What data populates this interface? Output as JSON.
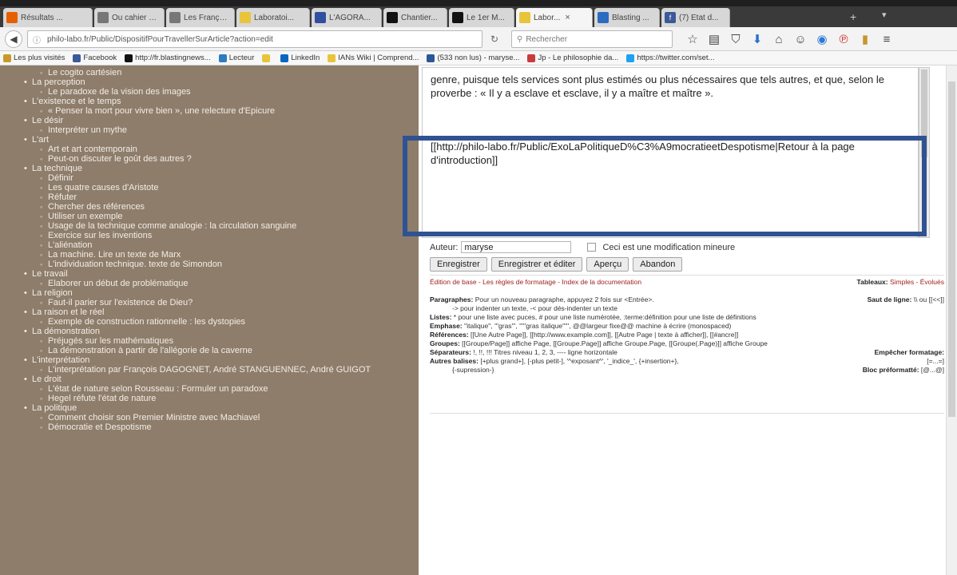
{
  "tabs": [
    {
      "title": "Résultats ...",
      "favicon": "firefox",
      "color": "#e66000"
    },
    {
      "title": "Ou cahier de l...",
      "favicon": "page",
      "color": "#777777"
    },
    {
      "title": "Les Français a...",
      "favicon": "page",
      "color": "#777777"
    },
    {
      "title": "Laboratoi...",
      "favicon": "yellow",
      "color": "#e8c43a"
    },
    {
      "title": "L'AGORA...",
      "favicon": "agora",
      "color": "#2f4f9f"
    },
    {
      "title": "Chantier...",
      "favicon": "dot",
      "color": "#111111"
    },
    {
      "title": "Le 1er M...",
      "favicon": "dot",
      "color": "#111111"
    },
    {
      "title": "Labor...",
      "favicon": "philo",
      "color": "#e8c43a",
      "active": true
    },
    {
      "title": "Blasting ...",
      "favicon": "blasting",
      "color": "#2c6bbf"
    },
    {
      "title": "(7) Etat d...",
      "favicon": "facebook",
      "color": "#3b5998"
    }
  ],
  "nav": {
    "url": "philo-labo.fr/Public/DispositifPourTravellerSurArticle?action=edit",
    "search_placeholder": "Rechercher"
  },
  "bookmarks": [
    {
      "label": "Les plus visités",
      "color": "#c89a2a"
    },
    {
      "label": "Facebook",
      "color": "#3b5998"
    },
    {
      "label": "http://fr.blastingnews...",
      "color": "#111111"
    },
    {
      "label": "Lecteur",
      "color": "#2c7cc0"
    },
    {
      "label": "",
      "color": "#e8c43a"
    },
    {
      "label": "LinkedIn",
      "color": "#0a66c2"
    },
    {
      "label": "IANs Wiki | Comprend...",
      "color": "#e8c43a"
    },
    {
      "label": "(533 non lus) - maryse...",
      "color": "#2b5797"
    },
    {
      "label": "Jp - Le philosophie da...",
      "color": "#cc3b3b"
    },
    {
      "label": "https://twitter.com/set...",
      "color": "#1da1f2"
    }
  ],
  "sidebar": [
    {
      "level": "sub",
      "label": "Le cogito cartésien"
    },
    {
      "level": "cat",
      "label": "La perception"
    },
    {
      "level": "sub",
      "label": "Le paradoxe de la vision des images"
    },
    {
      "level": "cat",
      "label": "L'existence et le temps"
    },
    {
      "level": "sub",
      "label": "« Penser la mort pour vivre bien », une relecture d'Epicure"
    },
    {
      "level": "cat",
      "label": "Le désir"
    },
    {
      "level": "sub",
      "label": "Interpréter un mythe"
    },
    {
      "level": "cat",
      "label": "L'art"
    },
    {
      "level": "sub",
      "label": "Art et art contemporain"
    },
    {
      "level": "sub",
      "label": "Peut-on discuter le goût des autres ?"
    },
    {
      "level": "cat",
      "label": "La technique"
    },
    {
      "level": "sub",
      "label": "Définir"
    },
    {
      "level": "sub",
      "label": "Les quatre causes d'Aristote"
    },
    {
      "level": "sub",
      "label": "Réfuter"
    },
    {
      "level": "sub",
      "label": "Chercher des références"
    },
    {
      "level": "sub",
      "label": "Utiliser un exemple"
    },
    {
      "level": "sub",
      "label": "Usage de la technique comme analogie : la circulation sanguine"
    },
    {
      "level": "sub",
      "label": "Exercice sur les inventions"
    },
    {
      "level": "sub",
      "label": "L'aliénation"
    },
    {
      "level": "sub",
      "label": "La machine. Lire un texte de Marx"
    },
    {
      "level": "sub",
      "label": "L'individuation technique. texte de Simondon"
    },
    {
      "level": "cat",
      "label": "Le travail"
    },
    {
      "level": "sub",
      "label": "Elaborer un début de problématique"
    },
    {
      "level": "cat",
      "label": "La religion"
    },
    {
      "level": "sub",
      "label": "Faut-il parier sur l'existence de Dieu?"
    },
    {
      "level": "cat",
      "label": "La raison et le réel"
    },
    {
      "level": "sub",
      "label": "Exemple de construction rationnelle : les dystopies"
    },
    {
      "level": "cat",
      "label": "La démonstration"
    },
    {
      "level": "sub",
      "label": "Préjugés sur les mathématiques"
    },
    {
      "level": "sub",
      "label": "La démonstration à partir de l'allégorie de la caverne"
    },
    {
      "level": "cat",
      "label": "L'interprétation"
    },
    {
      "level": "sub",
      "label": "L'interprétation par François DAGOGNET, André STANGUENNEC, André GUIGOT"
    },
    {
      "level": "cat",
      "label": "Le droit"
    },
    {
      "level": "sub",
      "label": "L'état de nature selon Rousseau : Formuler un paradoxe"
    },
    {
      "level": "sub",
      "label": "Hegel réfute l'état de nature"
    },
    {
      "level": "cat",
      "label": "La politique"
    },
    {
      "level": "sub",
      "label": "Comment choisir son Premier Ministre avec Machiavel"
    },
    {
      "level": "sub",
      "label": "Démocratie et Despotisme"
    }
  ],
  "editor": {
    "para1": "genre, puisque tels services sont plus estimés ou plus nécessaires que tels autres, et que, selon le proverbe : « Il y a esclave et esclave, il y a maître et maître ».",
    "para2": "[[http://philo-labo.fr/Public/ExoLaPolitiqueD%C3%A9mocratieetDespotisme|Retour à la page d'introduction]]"
  },
  "form": {
    "author_label": "Auteur:",
    "author_value": "maryse",
    "minor_label": "Ceci est une modification mineure",
    "buttons": [
      "Enregistrer",
      "Enregistrer et éditer",
      "Aperçu",
      "Abandon"
    ]
  },
  "help": {
    "links": "Édition de base - Les règles de formatage - Index de la documentation",
    "tables": "Tableaux:",
    "tables_links": "Simples - Évolués",
    "para_label": "Paragraphes:",
    "para_text": "Pour un nouveau paragraphe, appuyez 2 fois sur <Entrée>.",
    "para_text2": "-> pour indenter un texte, -< pour dés-indenter un texte",
    "linebreak_label": "Saut de ligne:",
    "linebreak_text": "\\\\ ou [[<<]]",
    "lists_label": "Listes:",
    "lists_text": "* pour une liste avec puces, # pour une liste numérotée, :terme:définition pour une liste de définitions",
    "emph_label": "Emphase:",
    "emph_text": "''italique'', '''gras''', '''''gras italique''''', @@largeur fixe@@ machine à écrire (monospaced)",
    "refs_label": "Références:",
    "refs_text": "[[Une Autre Page]], [[http://www.example.com]], [[Autre Page | texte à afficher]], [[#ancre]]",
    "groups_label": "Groupes:",
    "groups_text": "[[Groupe/Page]] affiche Page, [[Groupe.Page]] affiche Groupe.Page, [[Groupe(.Page)]] affiche Groupe",
    "sep_label": "Séparateurs:",
    "sep_text": "!, !!, !!! Titres niveau 1, 2, 3, ---- ligne horizontale",
    "noformat_label": "Empêcher formatage:",
    "noformat_text": "[=...=]",
    "tags_label": "Autres balises:",
    "tags_text": "[+plus grand+], [-plus petit-], '^exposant^', '_indice_', {+insertion+},",
    "tags_text2": "{-supression-}",
    "preformat_label": "Bloc préformatté:",
    "preformat_text": "[@...@]"
  }
}
